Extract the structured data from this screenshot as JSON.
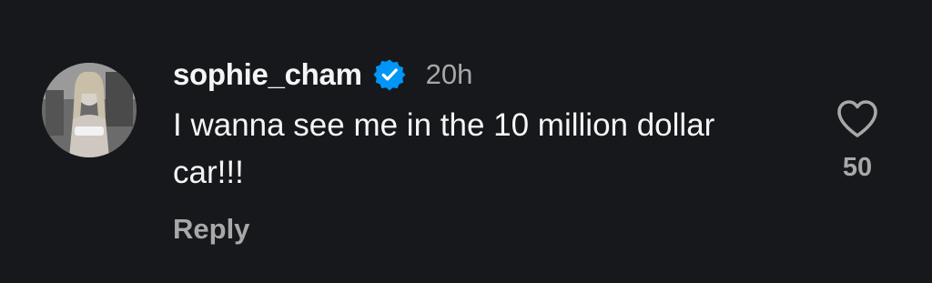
{
  "comment": {
    "username": "sophie_cham",
    "verified": true,
    "time": "20h",
    "text": "I wanna see me in the 10 million dollar car!!!",
    "reply_label": "Reply",
    "like_count": "50"
  },
  "icons": {
    "verified": "verified-badge-icon",
    "like": "heart-outline-icon"
  },
  "colors": {
    "background": "#16181c",
    "primary_text": "#f5f5f5",
    "secondary_text": "#a8a8a8",
    "verified_blue": "#0095f6"
  }
}
